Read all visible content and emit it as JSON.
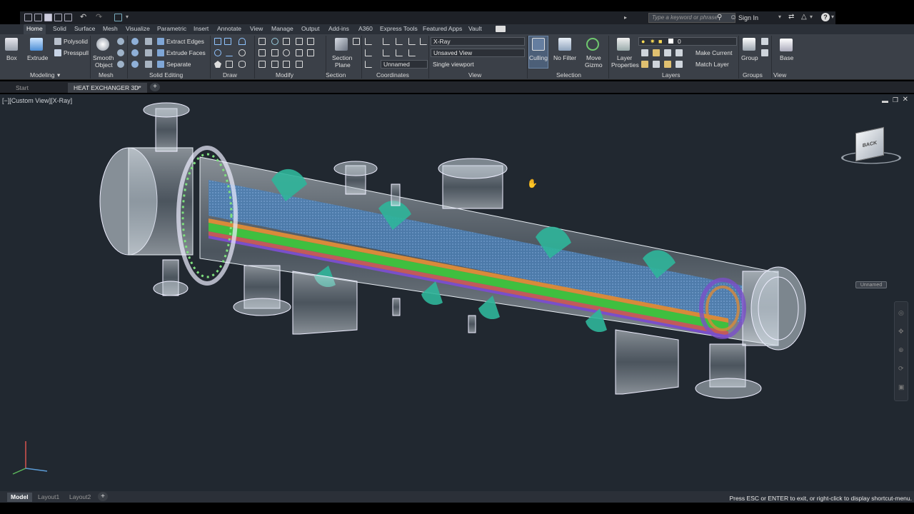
{
  "quick_access": {
    "icons": [
      "new-icon",
      "open-icon",
      "save-icon",
      "saveas-icon",
      "print-icon",
      "undo-icon",
      "redo-icon",
      "share-icon"
    ]
  },
  "search": {
    "placeholder": "Type a keyword or phrase"
  },
  "account": {
    "sign_in": "Sign In"
  },
  "ribbon_tabs": [
    "Home",
    "Solid",
    "Surface",
    "Mesh",
    "Visualize",
    "Parametric",
    "Insert",
    "Annotate",
    "View",
    "Manage",
    "Output",
    "Add-ins",
    "A360",
    "Express Tools",
    "Featured Apps",
    "Vault"
  ],
  "active_tab": "Home",
  "panels": {
    "modeling": {
      "label": "Modeling",
      "box": "Box",
      "extrude": "Extrude",
      "polysolid": "Polysolid",
      "presspull": "Presspull"
    },
    "mesh": {
      "label": "Mesh",
      "smooth_object_1": "Smooth",
      "smooth_object_2": "Object"
    },
    "solid_editing": {
      "label": "Solid Editing",
      "extract_edges": "Extract Edges",
      "extrude_faces": "Extrude Faces",
      "separate": "Separate"
    },
    "draw": {
      "label": "Draw"
    },
    "modify": {
      "label": "Modify"
    },
    "section": {
      "label": "Section",
      "section_plane_1": "Section",
      "section_plane_2": "Plane"
    },
    "coordinates": {
      "label": "Coordinates",
      "ucs": "Unnamed"
    },
    "view": {
      "label": "View",
      "visual_style": "X-Ray",
      "named_view": "Unsaved View",
      "viewport": "Single viewport"
    },
    "selection": {
      "label": "Selection",
      "culling": "Culling",
      "no_filter": "No Filter",
      "move_gizmo_1": "Move",
      "move_gizmo_2": "Gizmo"
    },
    "layers": {
      "label": "Layers",
      "layer_properties_1": "Layer",
      "layer_properties_2": "Properties",
      "layer_name": "0",
      "make_current": "Make Current",
      "match_layer": "Match Layer"
    },
    "groups": {
      "label": "Groups",
      "group": "Group"
    },
    "view2": {
      "label": "View",
      "base": "Base"
    }
  },
  "doc_tabs": [
    "Start",
    "HEAT EXCHANGER 3D*"
  ],
  "viewport": {
    "label": "[−][Custom View][X-Ray]",
    "viewcube_face": "BACK",
    "ucs_name": "Unnamed"
  },
  "layout_tabs": [
    "Model",
    "Layout1",
    "Layout2"
  ],
  "status_message": "Press ESC or ENTER to exit, or right-click to display shortcut-menu.",
  "colors": {
    "accent": "#3a8ee6",
    "viewport_bg": "#212830",
    "ribbon_bg": "#3b4048",
    "tube_green": "#3fbf3f",
    "baffle_teal": "#2fb59a"
  }
}
